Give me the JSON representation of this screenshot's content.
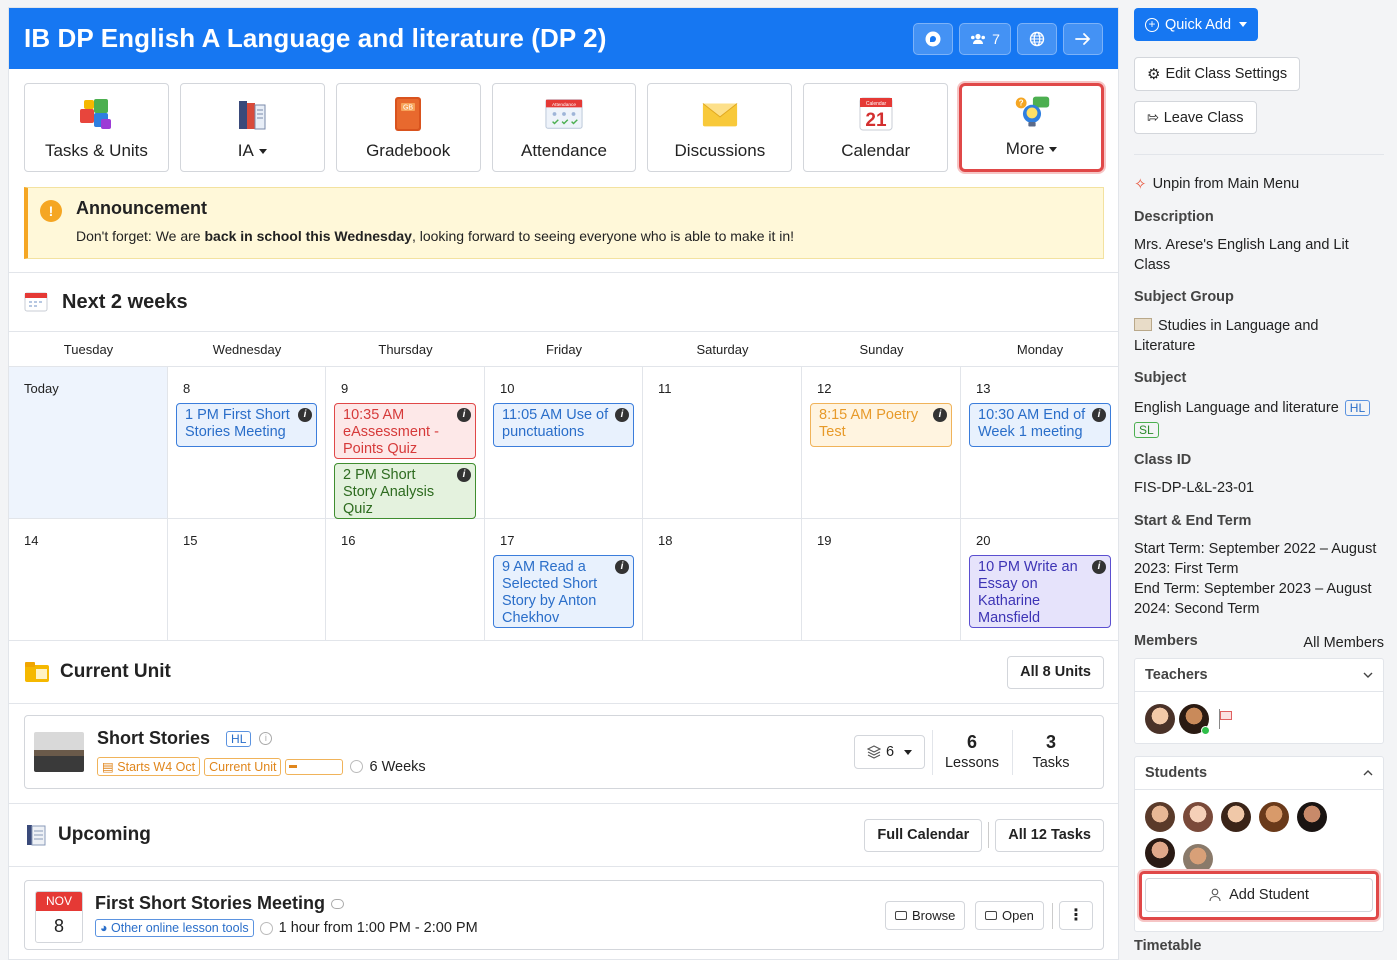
{
  "header": {
    "title": "IB DP English A Language and literature (DP 2)",
    "members_count": "7"
  },
  "tiles": [
    {
      "label": "Tasks & Units",
      "icon": "puzzle-icon",
      "caret": false
    },
    {
      "label": "IA",
      "icon": "books-icon",
      "caret": true
    },
    {
      "label": "Gradebook",
      "icon": "gradebook-icon",
      "caret": false
    },
    {
      "label": "Attendance",
      "icon": "attendance-icon",
      "caret": false
    },
    {
      "label": "Discussions",
      "icon": "envelope-icon",
      "caret": false
    },
    {
      "label": "Calendar",
      "icon": "calendar-icon",
      "caret": false
    },
    {
      "label": "More",
      "icon": "bulb-icon",
      "caret": true
    }
  ],
  "tile_icons": {
    "gradebook_badge": "GB",
    "attendance_badge": "Attendance",
    "calendar_badge": "Calendar",
    "calendar_day": "21"
  },
  "announcement": {
    "title": "Announcement",
    "text_before": "Don't forget: We are ",
    "text_bold": "back in school this Wednesday",
    "text_after": ", looking forward to seeing everyone who is able to make it in!"
  },
  "next_weeks": {
    "title": "Next 2 weeks",
    "days": [
      "Tuesday",
      "Wednesday",
      "Thursday",
      "Friday",
      "Saturday",
      "Sunday",
      "Monday"
    ],
    "rows": [
      [
        {
          "date": "Today",
          "today": true,
          "events": []
        },
        {
          "date": "8",
          "events": [
            {
              "text": "1 PM First Short Stories Meeting",
              "color": "b"
            }
          ]
        },
        {
          "date": "9",
          "events": [
            {
              "text": "10:35 AM eAssessment - Points Quiz",
              "color": "r"
            },
            {
              "text": "2 PM Short Story Analysis Quiz",
              "color": "g"
            }
          ]
        },
        {
          "date": "10",
          "events": [
            {
              "text": "11:05 AM Use of punctuations",
              "color": "b"
            }
          ]
        },
        {
          "date": "11",
          "events": []
        },
        {
          "date": "12",
          "events": [
            {
              "text": "8:15 AM Poetry Test",
              "color": "o"
            }
          ]
        },
        {
          "date": "13",
          "events": [
            {
              "text": "10:30 AM End of Week 1 meeting",
              "color": "b"
            }
          ]
        }
      ],
      [
        {
          "date": "14",
          "events": []
        },
        {
          "date": "15",
          "events": []
        },
        {
          "date": "16",
          "events": []
        },
        {
          "date": "17",
          "events": [
            {
              "text": "9 AM Read a Selected Short Story by Anton Chekhov",
              "color": "b"
            }
          ]
        },
        {
          "date": "18",
          "events": []
        },
        {
          "date": "19",
          "events": []
        },
        {
          "date": "20",
          "events": [
            {
              "text": "10 PM Write an Essay on Katharine Mansfield",
              "color": "p"
            }
          ]
        }
      ]
    ]
  },
  "current_unit": {
    "title": "Current Unit",
    "all_units": "All 8 Units",
    "unit_name": "Short Stories",
    "level": "HL",
    "tag_start": "Starts W4 Oct",
    "tag_current": "Current Unit",
    "progress": 0.15,
    "duration": "6 Weeks",
    "layers_count": "6",
    "lessons_count": "6",
    "lessons_label": "Lessons",
    "tasks_count": "3",
    "tasks_label": "Tasks"
  },
  "upcoming": {
    "title": "Upcoming",
    "full_calendar": "Full Calendar",
    "all_tasks": "All 12 Tasks",
    "item": {
      "month": "NOV",
      "day": "8",
      "title": "First Short Stories Meeting",
      "tag": "Other online lesson tools",
      "time": "1 hour from 1:00 PM - 2:00 PM",
      "browse": "Browse",
      "open": "Open"
    }
  },
  "sidebar": {
    "quick_add": "Quick Add",
    "edit_settings": "Edit Class Settings",
    "leave_class": "Leave Class",
    "unpin": "Unpin from Main Menu",
    "description_label": "Description",
    "description": "Mrs. Arese's English Lang and Lit Class",
    "subject_group_label": "Subject Group",
    "subject_group": "Studies in Language and Literature",
    "subject_label": "Subject",
    "subject": "English Language and literature",
    "subject_hl": "HL",
    "subject_sl": "SL",
    "class_id_label": "Class ID",
    "class_id": "FIS-DP-L&L-23-01",
    "term_label": "Start & End Term",
    "start_term": "Start Term: September 2022 – August 2023: First Term",
    "end_term": "End Term: September 2023 – August 2024: Second Term",
    "members_label": "Members",
    "all_members": "All Members",
    "teachers_label": "Teachers",
    "students_label": "Students",
    "add_student": "Add Student",
    "timetable_label": "Timetable"
  },
  "colors": {
    "brand": "#1677f2",
    "highlight": "#e04848",
    "announcement_bg": "#fff8d9"
  }
}
